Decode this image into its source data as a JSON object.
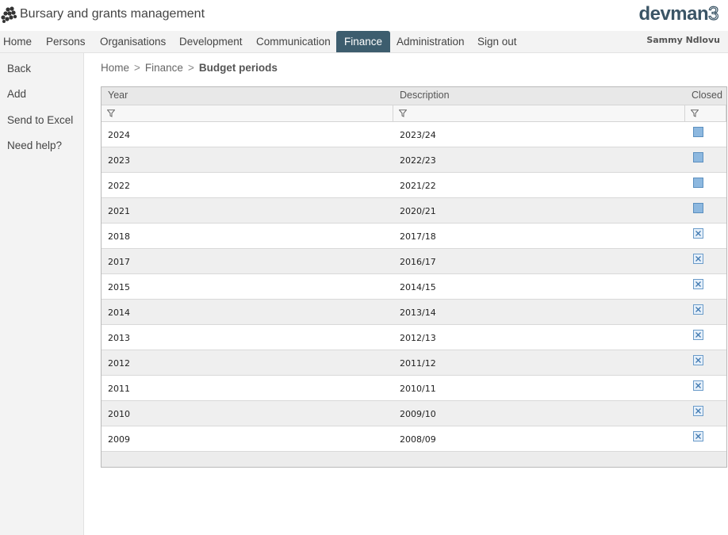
{
  "header": {
    "app_title": "Bursary and grants management",
    "brand_main": "devman",
    "brand_suffix": "3",
    "logo_icon": "cluster-dots-logo"
  },
  "nav": {
    "items": [
      {
        "label": "Home"
      },
      {
        "label": "Persons"
      },
      {
        "label": "Organisations"
      },
      {
        "label": "Development"
      },
      {
        "label": "Communication"
      },
      {
        "label": "Finance",
        "active": true
      },
      {
        "label": "Administration"
      },
      {
        "label": "Sign out"
      }
    ],
    "user_name": "Sammy Ndlovu",
    "active_color": "#3d5d6e"
  },
  "sidebar": {
    "items": [
      {
        "label": "Back"
      },
      {
        "label": "Add"
      },
      {
        "label": "Send to Excel"
      },
      {
        "label": "Need help?"
      }
    ]
  },
  "breadcrumb": {
    "items": [
      "Home",
      "Finance"
    ],
    "separator": ">",
    "current": "Budget periods"
  },
  "grid": {
    "columns": [
      "Year",
      "Description",
      "Closed"
    ],
    "filter_icon": "funnel-filter-icon",
    "rows": [
      {
        "year": "2024",
        "description": "2023/24",
        "closed": false
      },
      {
        "year": "2023",
        "description": "2022/23",
        "closed": false
      },
      {
        "year": "2022",
        "description": "2021/22",
        "closed": false
      },
      {
        "year": "2021",
        "description": "2020/21",
        "closed": false
      },
      {
        "year": "2018",
        "description": "2017/18",
        "closed": true
      },
      {
        "year": "2017",
        "description": "2016/17",
        "closed": true
      },
      {
        "year": "2015",
        "description": "2014/15",
        "closed": true
      },
      {
        "year": "2014",
        "description": "2013/14",
        "closed": true
      },
      {
        "year": "2013",
        "description": "2012/13",
        "closed": true
      },
      {
        "year": "2012",
        "description": "2011/12",
        "closed": true
      },
      {
        "year": "2011",
        "description": "2010/11",
        "closed": true
      },
      {
        "year": "2010",
        "description": "2009/10",
        "closed": true
      },
      {
        "year": "2009",
        "description": "2008/09",
        "closed": true
      }
    ]
  }
}
